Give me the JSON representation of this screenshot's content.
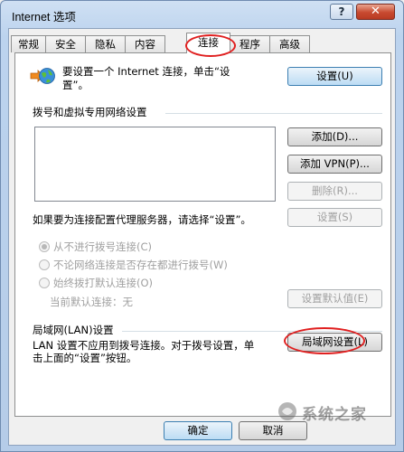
{
  "window": {
    "title": "Internet 选项",
    "help_label": "?",
    "close_label": "✕"
  },
  "tabs": [
    {
      "label": "常规"
    },
    {
      "label": "安全"
    },
    {
      "label": "隐私"
    },
    {
      "label": "内容"
    },
    {
      "label": "连接",
      "active": true
    },
    {
      "label": "程序"
    },
    {
      "label": "高级"
    }
  ],
  "setup": {
    "text_line1": "要设置一个 Internet 连接，单击“设",
    "text_line2": "置”。",
    "button": "设置(U)",
    "icon": "network-globe-icon"
  },
  "dialup": {
    "heading": "拨号和虚拟专用网络设置",
    "add_button": "添加(D)...",
    "add_vpn_button": "添加 VPN(P)...",
    "remove_button": "删除(R)...",
    "proxy_text": "如果要为连接配置代理服务器，请选择“设置”。",
    "settings_button": "设置(S)",
    "options": [
      {
        "label": "从不进行拨号连接(C)",
        "checked": true
      },
      {
        "label": "不论网络连接是否存在都进行拨号(W)",
        "checked": false
      },
      {
        "label": "始终拨打默认连接(O)",
        "checked": false
      }
    ],
    "current_default_label": "当前默认连接：",
    "current_default_value": "无",
    "set_default_button": "设置默认值(E)"
  },
  "lan": {
    "heading": "局域网(LAN)设置",
    "text_line1": "LAN 设置不应用到拨号连接。对于拨号设置，单",
    "text_line2": "击上面的“设置”按钮。",
    "button": "局域网设置(L)"
  },
  "footer": {
    "ok_button": "确定",
    "cancel_button": "取消"
  },
  "watermark": {
    "text": "系统之家"
  },
  "colors": {
    "highlight": "#e02020",
    "title_bar": "#bcd3ee",
    "close_button": "#c84a30"
  }
}
